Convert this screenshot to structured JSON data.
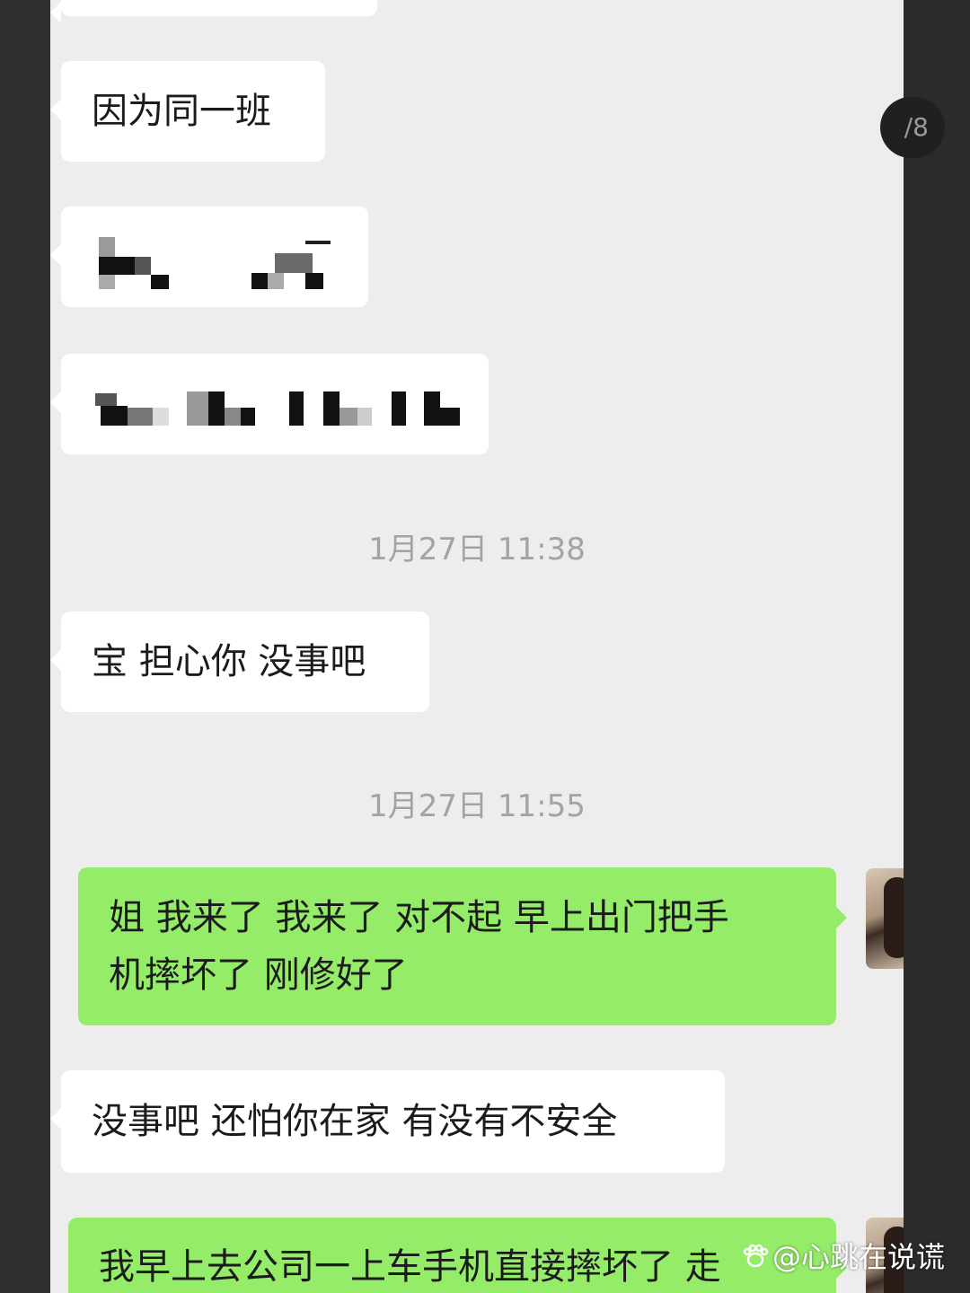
{
  "page_counter": "/8",
  "messages": [
    {
      "text": "因为同一班"
    },
    {
      "text": "宝 担心你 没事吧"
    },
    {
      "line1": "姐 我来了 我来了 对不起 早上出门把手",
      "line2": "机摔坏了 刚修好了"
    },
    {
      "text": "没事吧 还怕你在家 有没有不安全"
    },
    {
      "text": "我早上去公司一上车手机直接摔坏了 走"
    }
  ],
  "timestamps": [
    "1月27日 11:38",
    "1月27日 11:55"
  ],
  "watermark": "@心跳在说谎",
  "colors": {
    "incoming_bubble": "#ffffff",
    "outgoing_bubble": "#95ec69",
    "chat_background": "#ededed",
    "timestamp_text": "#a3a3a3"
  }
}
